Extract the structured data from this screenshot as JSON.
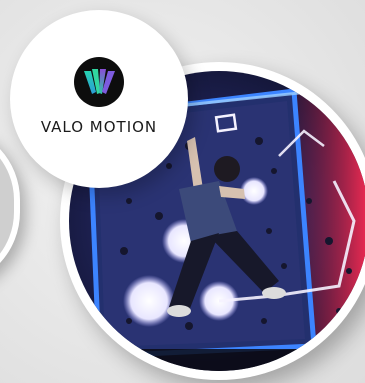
{
  "brand": {
    "name": "VALO MOTION",
    "logo_icon": "valo-motion-logo-icon"
  },
  "colors": {
    "background": "#e6e6e6",
    "logo_teal": "#27d3b2",
    "logo_purple": "#8a4dd6",
    "wall_blue": "#2c6de0",
    "wall_red": "#e2264a",
    "neon_white": "#f5f2ff"
  }
}
